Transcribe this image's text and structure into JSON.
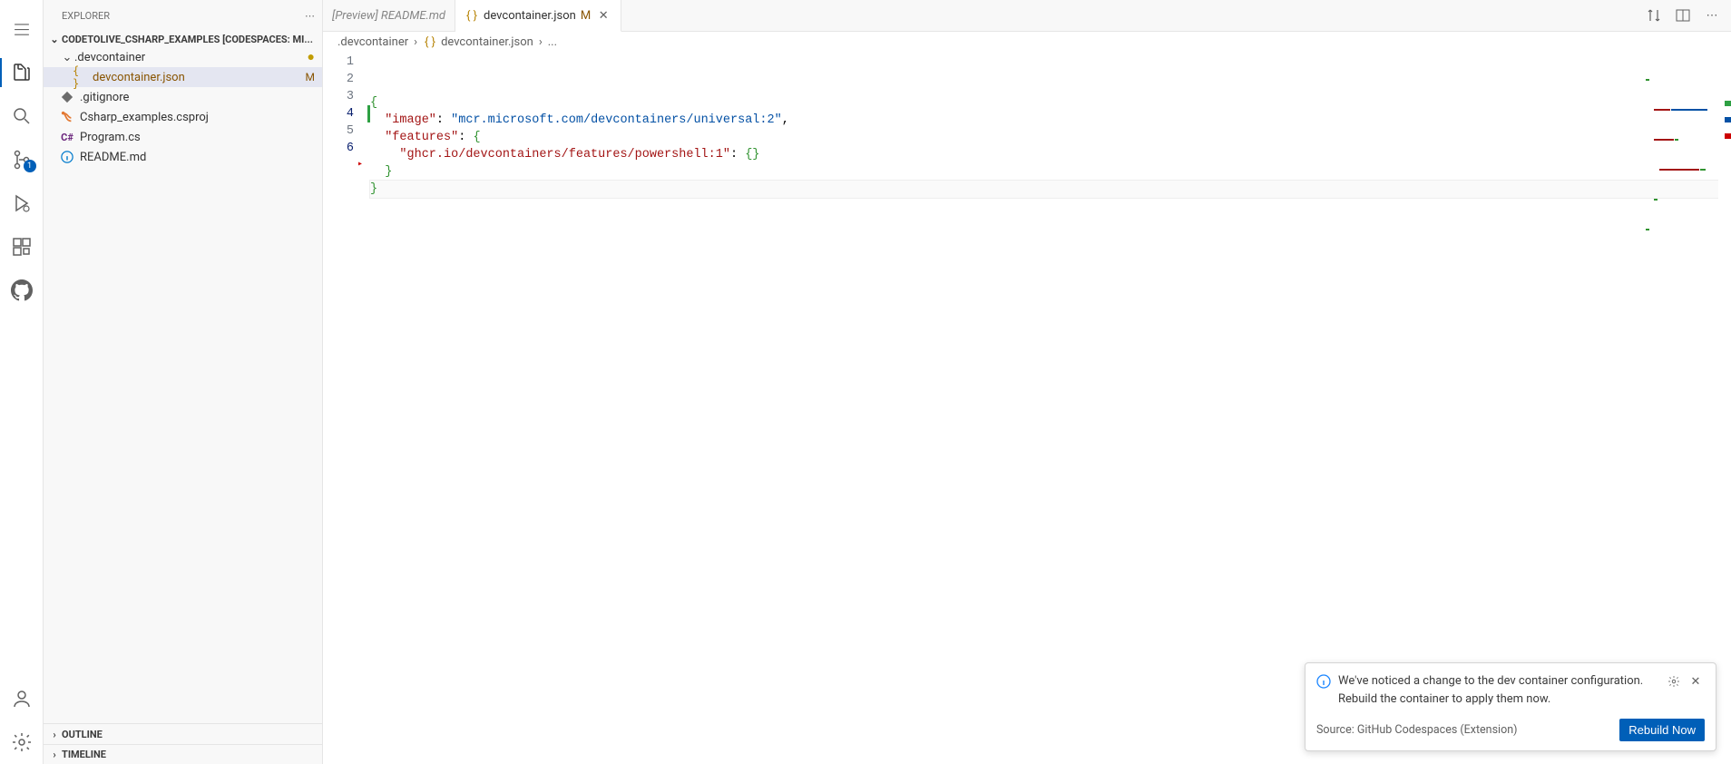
{
  "activity_bar": {
    "items": [
      {
        "name": "menu-icon"
      },
      {
        "name": "explorer-icon",
        "active": true
      },
      {
        "name": "search-icon"
      },
      {
        "name": "source-control-icon",
        "badge": "1"
      },
      {
        "name": "run-debug-icon"
      },
      {
        "name": "extensions-icon"
      },
      {
        "name": "github-icon"
      }
    ],
    "bottom": [
      {
        "name": "accounts-icon"
      },
      {
        "name": "settings-gear-icon"
      }
    ]
  },
  "sidebar": {
    "header_label": "EXPLORER",
    "project_title": "CODETOLIVE_CSHARP_EXAMPLES [CODESPACES: MI...",
    "tree": [
      {
        "type": "folder",
        "label": ".devcontainer",
        "expanded": true,
        "modified_dot": true,
        "depth": 0
      },
      {
        "type": "file",
        "label": "devcontainer.json",
        "icon": "json-icon",
        "status": "M",
        "selected": true,
        "modified": true,
        "depth": 1
      },
      {
        "type": "file",
        "label": ".gitignore",
        "icon": "git-icon",
        "depth": 0
      },
      {
        "type": "file",
        "label": "Csharp_examples.csproj",
        "icon": "xml-icon",
        "depth": 0
      },
      {
        "type": "file",
        "label": "Program.cs",
        "icon": "csharp-icon",
        "depth": 0
      },
      {
        "type": "file",
        "label": "README.md",
        "icon": "info-icon",
        "depth": 0
      }
    ],
    "sections": {
      "outline": "OUTLINE",
      "timeline": "TIMELINE"
    }
  },
  "tabs": [
    {
      "label": "[Preview] README.md",
      "preview": true,
      "active": false
    },
    {
      "label": "devcontainer.json",
      "status": "M",
      "active": true,
      "icon": "json-icon",
      "close": true
    }
  ],
  "breadcrumb": {
    "segments": [
      {
        "label": ".devcontainer"
      },
      {
        "label": "devcontainer.json",
        "icon": "json-icon"
      },
      {
        "label": "..."
      }
    ]
  },
  "editor": {
    "lines": [
      {
        "num": "1",
        "indent": 0,
        "raw": "{",
        "tokens": [
          [
            "{",
            "brace"
          ]
        ]
      },
      {
        "num": "2",
        "indent": 1,
        "tokens": [
          [
            "\"image\"",
            "key"
          ],
          [
            ":",
            "punc"
          ],
          [
            " ",
            ""
          ],
          [
            "\"mcr.microsoft.com/devcontainers/universal:2\"",
            "str"
          ],
          [
            ",",
            "punc"
          ]
        ]
      },
      {
        "num": "3",
        "indent": 1,
        "tokens": [
          [
            "\"features\"",
            "key"
          ],
          [
            ":",
            "punc"
          ],
          [
            " ",
            ""
          ],
          [
            "{",
            "brace"
          ]
        ]
      },
      {
        "num": "4",
        "indent": 2,
        "git": "add",
        "cursor": true,
        "tokens": [
          [
            "\"ghcr.io/devcontainers/features/powershell:1\"",
            "key"
          ],
          [
            ":",
            "punc"
          ],
          [
            " ",
            ""
          ],
          [
            "{}",
            "brace"
          ]
        ]
      },
      {
        "num": "5",
        "indent": 1,
        "tokens": [
          [
            "}",
            "brace"
          ]
        ]
      },
      {
        "num": "6",
        "indent": 0,
        "cursor": true,
        "tokens": [
          [
            "}",
            "brace"
          ]
        ]
      }
    ]
  },
  "notification": {
    "message": "We've noticed a change to the dev container configuration. Rebuild the container to apply them now.",
    "source": "Source: GitHub Codespaces (Extension)",
    "action": "Rebuild Now"
  },
  "colors": {
    "accent": "#005fb8",
    "modified": "#895503"
  }
}
